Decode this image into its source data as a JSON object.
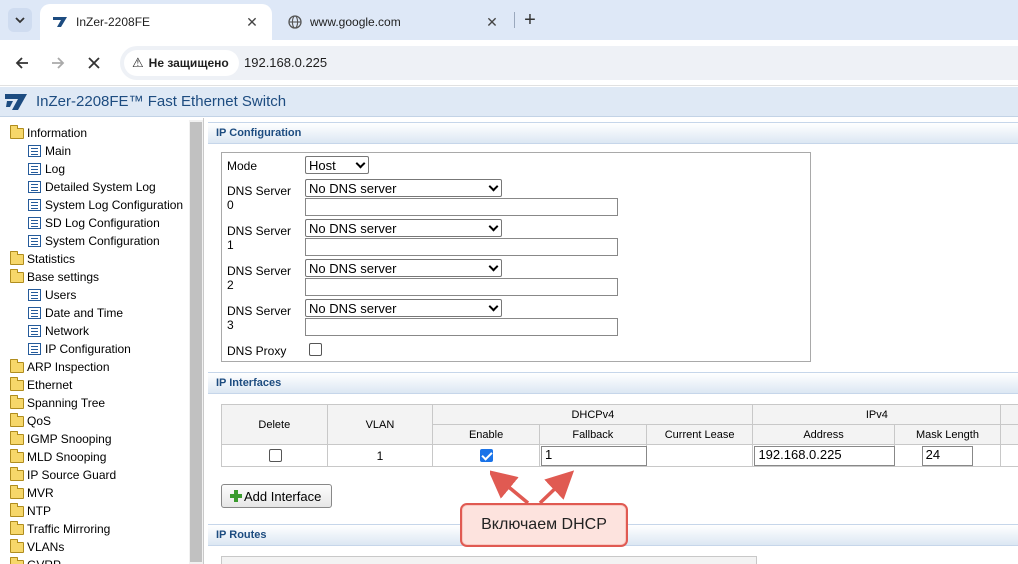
{
  "browser": {
    "tabs": [
      {
        "title": "InZer-2208FE",
        "active": true
      },
      {
        "title": "www.google.com",
        "active": false
      }
    ],
    "security_label": "Не защищено",
    "url": "192.168.0.225"
  },
  "app": {
    "title": "InZer-2208FE™ Fast Ethernet Switch",
    "accent": "#1d4c80"
  },
  "sidebar": {
    "items": [
      {
        "label": "Information",
        "type": "folder"
      },
      {
        "label": "Main",
        "type": "page"
      },
      {
        "label": "Log",
        "type": "page"
      },
      {
        "label": "Detailed System Log",
        "type": "page"
      },
      {
        "label": "System Log Configuration",
        "type": "page"
      },
      {
        "label": "SD Log Configuration",
        "type": "page"
      },
      {
        "label": "System Configuration",
        "type": "page"
      },
      {
        "label": "Statistics",
        "type": "folder"
      },
      {
        "label": "Base settings",
        "type": "folder"
      },
      {
        "label": "Users",
        "type": "page"
      },
      {
        "label": "Date and Time",
        "type": "page"
      },
      {
        "label": "Network",
        "type": "page"
      },
      {
        "label": "IP Configuration",
        "type": "page"
      },
      {
        "label": "ARP Inspection",
        "type": "folder"
      },
      {
        "label": "Ethernet",
        "type": "folder"
      },
      {
        "label": "Spanning Tree",
        "type": "folder"
      },
      {
        "label": "QoS",
        "type": "folder"
      },
      {
        "label": "IGMP Snooping",
        "type": "folder"
      },
      {
        "label": "MLD Snooping",
        "type": "folder"
      },
      {
        "label": "IP Source Guard",
        "type": "folder"
      },
      {
        "label": "MVR",
        "type": "folder"
      },
      {
        "label": "NTP",
        "type": "folder"
      },
      {
        "label": "Traffic Mirroring",
        "type": "folder"
      },
      {
        "label": "VLANs",
        "type": "folder"
      },
      {
        "label": "GVRP",
        "type": "folder"
      }
    ]
  },
  "ip_config": {
    "section_title": "IP Configuration",
    "mode_label": "Mode",
    "mode_value": "Host",
    "dns_servers": [
      {
        "label_line1": "DNS Server",
        "label_line2": "0",
        "value": "No DNS server",
        "text": ""
      },
      {
        "label_line1": "DNS Server",
        "label_line2": "1",
        "value": "No DNS server",
        "text": ""
      },
      {
        "label_line1": "DNS Server",
        "label_line2": "2",
        "value": "No DNS server",
        "text": ""
      },
      {
        "label_line1": "DNS Server",
        "label_line2": "3",
        "value": "No DNS server",
        "text": ""
      }
    ],
    "dns_proxy_label": "DNS Proxy",
    "dns_proxy_checked": false
  },
  "ip_interfaces": {
    "section_title": "IP Interfaces",
    "headers": {
      "delete": "Delete",
      "vlan": "VLAN",
      "dhcpv4": "DHCPv4",
      "ipv4": "IPv4",
      "enable": "Enable",
      "fallback": "Fallback",
      "current_lease": "Current Lease",
      "address": "Address",
      "mask_length": "Mask Length"
    },
    "rows": [
      {
        "delete": false,
        "vlan": "1",
        "dhcp_enable": true,
        "fallback": "1",
        "current_lease": "",
        "address": "192.168.0.225",
        "mask_length": "24"
      }
    ],
    "add_button": "Add Interface"
  },
  "ip_routes": {
    "section_title": "IP Routes"
  },
  "annotation": {
    "text": "Включаем DHCP",
    "border_color": "#e05a52",
    "fill_color": "#fde3de"
  }
}
